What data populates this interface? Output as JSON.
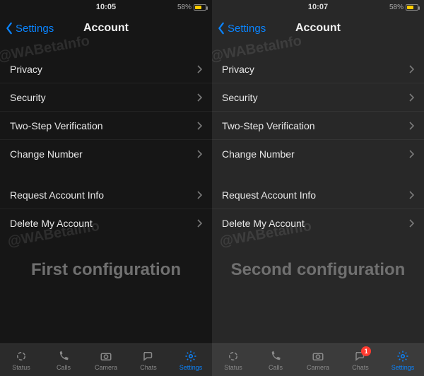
{
  "left": {
    "time": "10:05",
    "battery_pct": "58%",
    "back_label": "Settings",
    "title": "Account",
    "group1": [
      {
        "label": "Privacy"
      },
      {
        "label": "Security"
      },
      {
        "label": "Two-Step Verification"
      },
      {
        "label": "Change Number"
      }
    ],
    "group2": [
      {
        "label": "Request Account Info"
      },
      {
        "label": "Delete My Account"
      }
    ],
    "watermark": "@WABetaInfo",
    "caption": "First configuration",
    "tabs": {
      "status": "Status",
      "calls": "Calls",
      "camera": "Camera",
      "chats": "Chats",
      "settings": "Settings"
    }
  },
  "right": {
    "time": "10:07",
    "battery_pct": "58%",
    "back_label": "Settings",
    "title": "Account",
    "group1": [
      {
        "label": "Privacy"
      },
      {
        "label": "Security"
      },
      {
        "label": "Two-Step Verification"
      },
      {
        "label": "Change Number"
      }
    ],
    "group2": [
      {
        "label": "Request Account Info"
      },
      {
        "label": "Delete My Account"
      }
    ],
    "watermark": "@WABetaInfo",
    "caption": "Second configuration",
    "tabs": {
      "status": "Status",
      "calls": "Calls",
      "camera": "Camera",
      "chats": "Chats",
      "settings": "Settings"
    },
    "chats_badge": "1"
  }
}
